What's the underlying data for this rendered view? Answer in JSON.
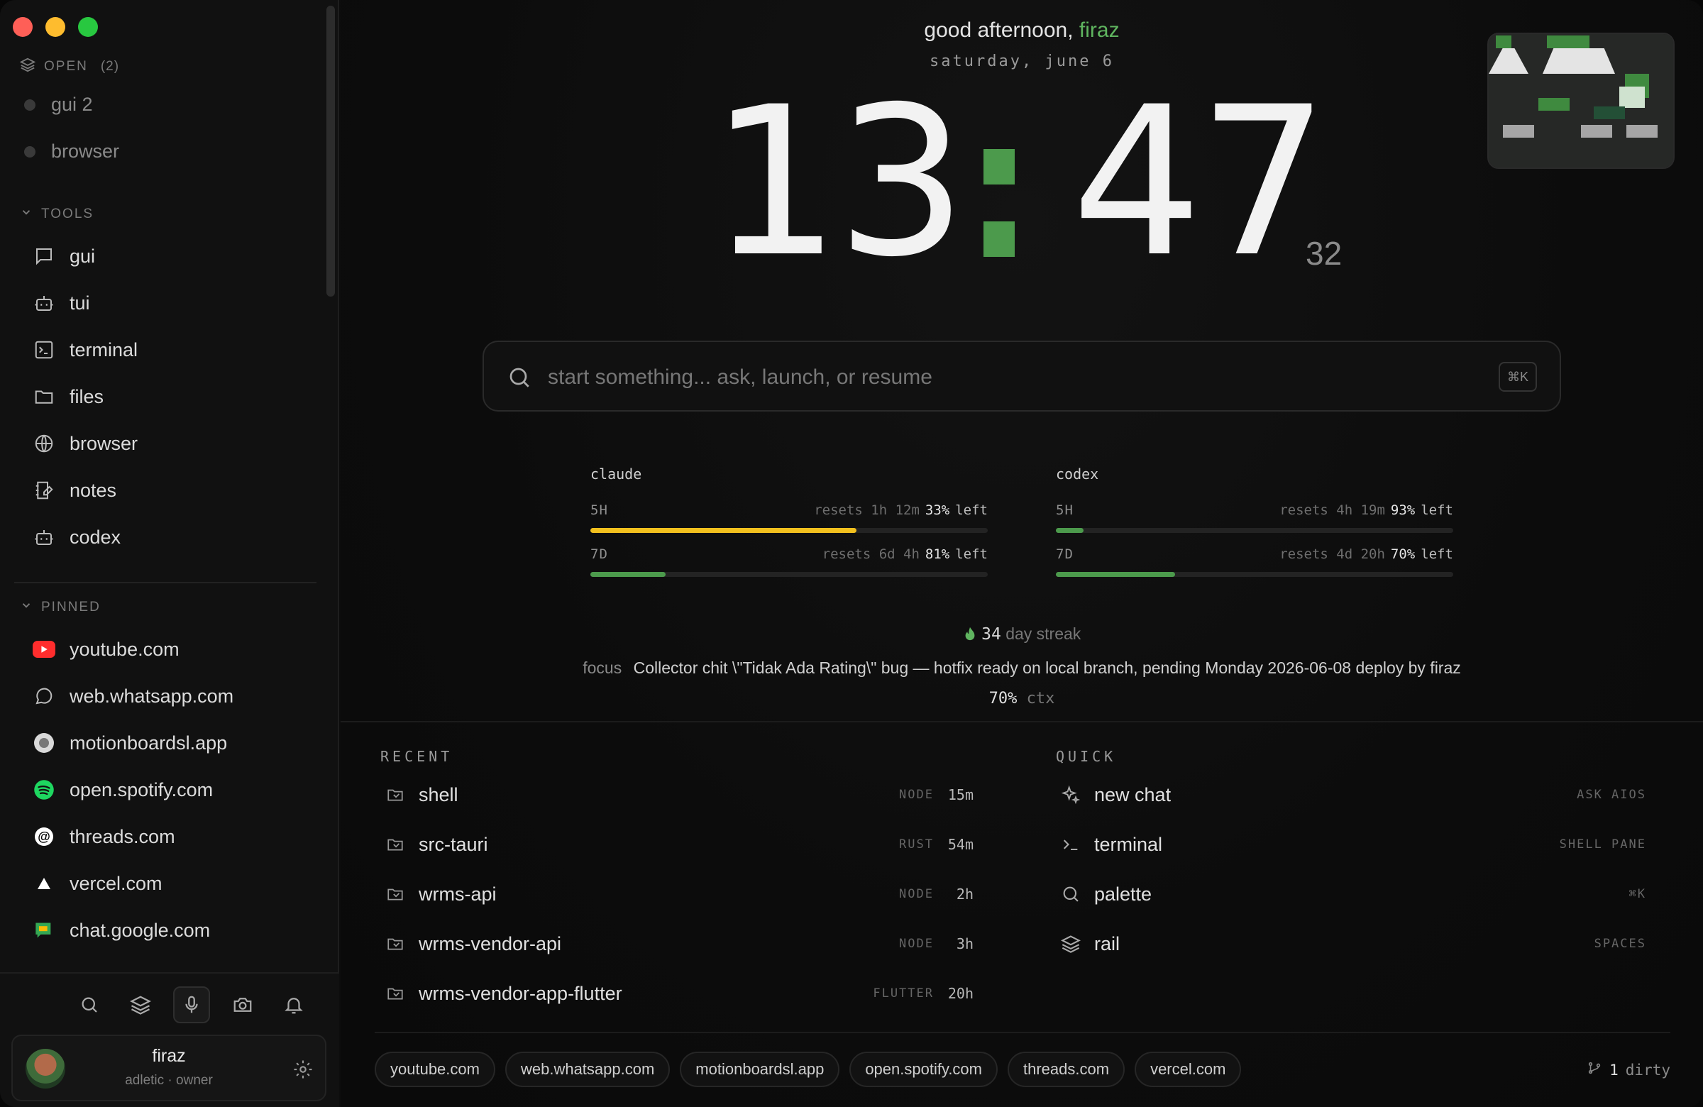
{
  "sidebar": {
    "open_header": "OPEN",
    "open_count": "(2)",
    "open_items": [
      {
        "label": "gui 2"
      },
      {
        "label": "browser"
      }
    ],
    "tools_header": "TOOLS",
    "tools": [
      {
        "label": "gui",
        "icon": "chat-icon"
      },
      {
        "label": "tui",
        "icon": "bot-icon"
      },
      {
        "label": "terminal",
        "icon": "terminal-icon"
      },
      {
        "label": "files",
        "icon": "folder-icon"
      },
      {
        "label": "browser",
        "icon": "globe-icon"
      },
      {
        "label": "notes",
        "icon": "notes-icon"
      },
      {
        "label": "codex",
        "icon": "bot-icon"
      }
    ],
    "pinned_header": "PINNED",
    "pinned": [
      {
        "label": "youtube.com",
        "color": "#ff2d2d"
      },
      {
        "label": "web.whatsapp.com",
        "color": "#9a9a9a"
      },
      {
        "label": "motionboardsl.app",
        "color": "#cfcfcf"
      },
      {
        "label": "open.spotify.com",
        "color": "#1ed760"
      },
      {
        "label": "threads.com",
        "color": "#ffffff"
      },
      {
        "label": "vercel.com",
        "color": "#ffffff"
      },
      {
        "label": "chat.google.com",
        "color": "#34a853"
      }
    ],
    "user": {
      "name": "firaz",
      "role": "adletic · owner"
    }
  },
  "main": {
    "greeting": "good afternoon,",
    "greeting_name": "firaz",
    "date": "saturday, june 6",
    "clock": {
      "hours": "13",
      "minutes": "47",
      "seconds": "32"
    },
    "search": {
      "placeholder": "start something... ask, launch, or resume",
      "shortcut": "⌘K"
    },
    "usage": [
      {
        "name": "claude",
        "rows": [
          {
            "period": "5H",
            "resets": "resets 1h 12m",
            "pct": "33%",
            "left": "left",
            "fill": 0.67,
            "color": "#f2c01e"
          },
          {
            "period": "7D",
            "resets": "resets 6d 4h",
            "pct": "81%",
            "left": "left",
            "fill": 0.19,
            "color": "#4c9a4c"
          }
        ]
      },
      {
        "name": "codex",
        "rows": [
          {
            "period": "5H",
            "resets": "resets 4h 19m",
            "pct": "93%",
            "left": "left",
            "fill": 0.07,
            "color": "#4c9a4c"
          },
          {
            "period": "7D",
            "resets": "resets 4d 20h",
            "pct": "70%",
            "left": "left",
            "fill": 0.3,
            "color": "#4c9a4c"
          }
        ]
      }
    ],
    "streak": {
      "count": "34",
      "label": "day streak"
    },
    "focus": {
      "label": "focus",
      "text": "Collector chit \\\"Tidak Ada Rating\\\" bug — hotfix ready on local branch, pending Monday 2026-06-08 deploy by firaz"
    },
    "ctx": {
      "value": "70%",
      "label": "ctx"
    },
    "recent_header": "RECENT",
    "recent": [
      {
        "name": "shell",
        "tag": "NODE",
        "time": "15m"
      },
      {
        "name": "src-tauri",
        "tag": "RUST",
        "time": "54m"
      },
      {
        "name": "wrms-api",
        "tag": "NODE",
        "time": "2h"
      },
      {
        "name": "wrms-vendor-api",
        "tag": "NODE",
        "time": "3h"
      },
      {
        "name": "wrms-vendor-app-flutter",
        "tag": "FLUTTER",
        "time": "20h"
      }
    ],
    "quick_header": "QUICK",
    "quick": [
      {
        "name": "new chat",
        "tag": "ASK AIOS",
        "icon": "sparkle-icon"
      },
      {
        "name": "terminal",
        "tag": "SHELL PANE",
        "icon": "prompt-icon"
      },
      {
        "name": "palette",
        "tag": "⌘K",
        "icon": "search-icon"
      },
      {
        "name": "rail",
        "tag": "SPACES",
        "icon": "layers-icon"
      }
    ],
    "chips": [
      "youtube.com",
      "web.whatsapp.com",
      "motionboardsl.app",
      "open.spotify.com",
      "threads.com",
      "vercel.com"
    ],
    "dirty": {
      "count": "1",
      "label": "dirty"
    }
  }
}
